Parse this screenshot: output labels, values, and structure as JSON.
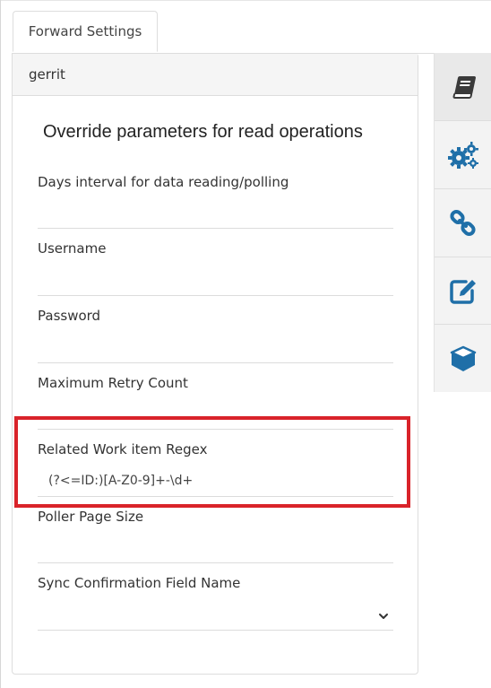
{
  "tab": {
    "label": "Forward Settings"
  },
  "panel": {
    "header": "gerrit",
    "section_title": "Override parameters for read operations",
    "fields": [
      {
        "label": "Days interval for data reading/polling",
        "value": ""
      },
      {
        "label": "Username",
        "value": ""
      },
      {
        "label": "Password",
        "value": ""
      },
      {
        "label": "Maximum Retry Count",
        "value": ""
      },
      {
        "label": "Related Work item Regex",
        "value": "(?<=ID:)[A-Z0-9]+-\\d+"
      },
      {
        "label": "Poller Page Size",
        "value": ""
      },
      {
        "label": "Sync Confirmation Field Name",
        "value": ""
      }
    ]
  },
  "sidebar": {
    "items": [
      {
        "icon": "book-icon",
        "active": true
      },
      {
        "icon": "gears-icon",
        "active": false
      },
      {
        "icon": "link-icon",
        "active": false
      },
      {
        "icon": "edit-icon",
        "active": false
      },
      {
        "icon": "cube-icon",
        "active": false
      }
    ]
  },
  "colors": {
    "accent_blue": "#1f6fa8",
    "active_icon": "#3a3a3a",
    "highlight_red": "#d9232a"
  }
}
